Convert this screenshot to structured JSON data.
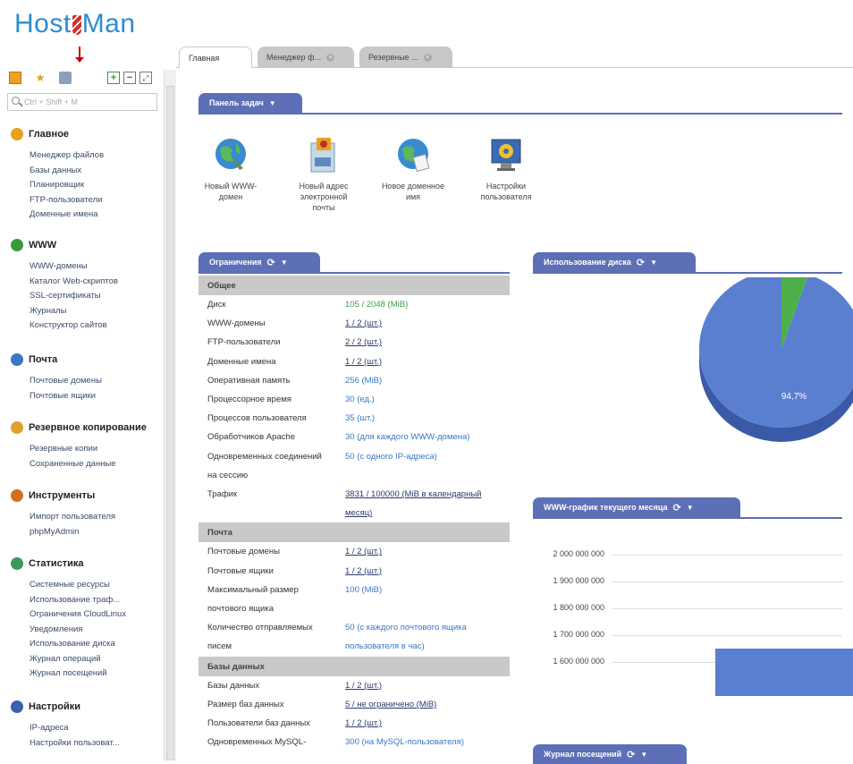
{
  "logo": {
    "part1": "Host",
    "part2": "Man"
  },
  "search": {
    "placeholder": "Ctrl + Shift + M"
  },
  "sidebar": [
    {
      "title": "Главное",
      "color": "#e8a020",
      "items": [
        "Менеджер файлов",
        "Базы данных",
        "Планировщик",
        "FTP-пользователи",
        "Доменные имена"
      ]
    },
    {
      "title": "WWW",
      "color": "#3a9a3a",
      "items": [
        "WWW-домены",
        "Каталог Web-скриптов",
        "SSL-сертификаты",
        "Журналы",
        "Конструктор сайтов"
      ]
    },
    {
      "title": "Почта",
      "color": "#3a78c2",
      "items": [
        "Почтовые домены",
        "Почтовые ящики"
      ]
    },
    {
      "title": "Резервное копирование",
      "color": "#e0a030",
      "items": [
        "Резервные копии",
        "Сохраненные данные"
      ]
    },
    {
      "title": "Инструменты",
      "color": "#d07020",
      "items": [
        "Импорт пользователя",
        "phpMyAdmin"
      ]
    },
    {
      "title": "Статистика",
      "color": "#3a9a5a",
      "items": [
        "Системные ресурсы",
        "Использование траф...",
        "Ограничения CloudLinux",
        "Уведомления",
        "Использование диска",
        "Журнал операций",
        "Журнал посещений"
      ]
    },
    {
      "title": "Настройки",
      "color": "#3a60b0",
      "items": [
        "IP-адреса",
        "Настройки пользоват..."
      ]
    }
  ],
  "tabs": [
    {
      "label": "Главная"
    },
    {
      "label": "Менеджер ф..."
    },
    {
      "label": "Резервные ..."
    }
  ],
  "taskpanel": {
    "title": "Панель задач",
    "items": [
      "Новый WWW-домен",
      "Новый адрес электронной почты",
      "Новое доменное имя",
      "Настройки пользователя"
    ]
  },
  "limits": {
    "title": "Ограничения",
    "categories": [
      {
        "name": "Общее",
        "rows": [
          {
            "label": "Диск",
            "value": "105 / 2048 (MiB)",
            "style": "g"
          },
          {
            "label": "WWW-домены",
            "value": "1 / 2 (шт.)",
            "style": "u"
          },
          {
            "label": "FTP-пользователи",
            "value": "2 / 2 (шт.)",
            "style": "u"
          },
          {
            "label": "Доменные имена",
            "value": "1 / 2 (шт.)",
            "style": "u"
          },
          {
            "label": "Оперативная память",
            "value": "256 (MiB)",
            "style": ""
          },
          {
            "label": "Процессорное время",
            "value": "30 (ед.)",
            "style": ""
          },
          {
            "label": "Процессов пользователя",
            "value": "35 (шт.)",
            "style": ""
          },
          {
            "label": "Обработчиков Apache",
            "value": "30 (для каждого WWW-домена)",
            "style": ""
          },
          {
            "label": "Одновременных соединений",
            "value": "50 (с одного IP-адреса)",
            "style": ""
          },
          {
            "label": "на сессию",
            "value": "",
            "style": ""
          },
          {
            "label": "Трафик",
            "value": "3831 / 100000 (MiB в календарный",
            "style": "u"
          },
          {
            "label": "",
            "value": "месяц)",
            "style": "u"
          }
        ]
      },
      {
        "name": "Почта",
        "rows": [
          {
            "label": "Почтовые домены",
            "value": "1 / 2 (шт.)",
            "style": "u"
          },
          {
            "label": "Почтовые ящики",
            "value": "1 / 2 (шт.)",
            "style": "u"
          },
          {
            "label": "Максимальный размер",
            "value": "100 (MiB)",
            "style": ""
          },
          {
            "label": "почтового ящика",
            "value": "",
            "style": ""
          },
          {
            "label": "Количество отправляемых",
            "value": "50 (с каждого почтового ящика",
            "style": ""
          },
          {
            "label": "писем",
            "value": "пользователя в час)",
            "style": ""
          }
        ]
      },
      {
        "name": "Базы данных",
        "rows": [
          {
            "label": "Базы данных",
            "value": "1 / 2 (шт.)",
            "style": "u"
          },
          {
            "label": "Размер баз данных",
            "value": "5 / не ограничено (MiB)",
            "style": "u"
          },
          {
            "label": "Пользователи баз данных",
            "value": "1 / 2 (шт.)",
            "style": "u"
          },
          {
            "label": "Одновременных MySQL-",
            "value": "300 (на MySQL-пользователя)",
            "style": ""
          }
        ]
      }
    ]
  },
  "disk": {
    "title": "Использование диска",
    "slice_label": "94,7%",
    "colors": {
      "used": "#4db04a",
      "free": "#5b7fd0"
    }
  },
  "traffic": {
    "title": "WWW-график текущего месяца",
    "bar_color": "#5b7fd0"
  },
  "visits": {
    "title": "Журнал посещений"
  },
  "chart_data": [
    {
      "type": "pie",
      "title": "Использование диска",
      "slices": [
        {
          "value": 94.7,
          "label": "94,7%"
        },
        {
          "value": 5.3,
          "label": ""
        }
      ]
    },
    {
      "type": "bar",
      "title": "WWW-график текущего месяца",
      "yticks": [
        "2 000 000 000",
        "1 900 000 000",
        "1 800 000 000",
        "1 700 000 000",
        "1 600 000 000"
      ],
      "ylim": [
        1600000000,
        2000000000
      ],
      "values": [
        1650000000
      ]
    }
  ]
}
